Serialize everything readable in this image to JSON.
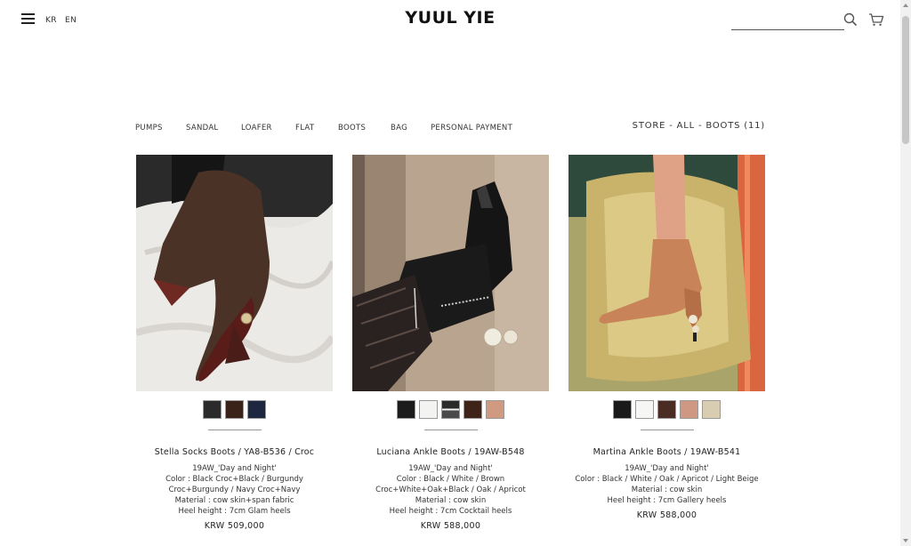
{
  "header": {
    "lang_kr": "KR",
    "lang_en": "EN",
    "logo": "YUUL YIE",
    "search_placeholder": ""
  },
  "categories": [
    "PUMPS",
    "SANDAL",
    "LOAFER",
    "FLAT",
    "BOOTS",
    "BAG",
    "PERSONAL PAYMENT"
  ],
  "breadcrumb": {
    "store": "STORE",
    "sep": " - ",
    "all": "ALL",
    "current": "BOOTS (11)"
  },
  "products": [
    {
      "name": "Stella Socks Boots / YA8-B536 / Croc",
      "desc": [
        "19AW_'Day and Night'",
        "Color : Black Croc+Black / Burgundy",
        "Croc+Burgundy / Navy Croc+Navy",
        "Material : cow skin+span fabric",
        "Heel height : 7cm Glam heels"
      ],
      "price": "KRW 509,000",
      "swatches": [
        "#2b2b2b",
        "#3a2218",
        "#1e2740"
      ]
    },
    {
      "name": "Luciana Ankle Boots / 19AW-B548",
      "desc": [
        "19AW_'Day and Night'",
        "Color : Black / White / Brown",
        "Croc+White+Oak+Black / Oak / Apricot",
        "Material : cow skin",
        "Heel height : 7cm Cocktail heels"
      ],
      "price": "KRW 588,000",
      "swatches": [
        "#1c1c1c",
        "#f3f3f1",
        "#3a3a3a",
        "#3e2418",
        "#cf9a80"
      ]
    },
    {
      "name": "Martina Ankle Boots / 19AW-B541",
      "desc": [
        "19AW_'Day and Night'",
        "Color : Black / White / Oak / Apricot / Light Beige",
        "Material : cow skin",
        "Heel height : 7cm Gallery heels"
      ],
      "price": "KRW 588,000",
      "swatches": [
        "#1a1a1a",
        "#f6f6f4",
        "#4a2c22",
        "#cf9883",
        "#d8cdb0"
      ]
    }
  ],
  "icons": {
    "menu": "menu-icon",
    "search": "search-icon",
    "cart": "cart-icon"
  }
}
